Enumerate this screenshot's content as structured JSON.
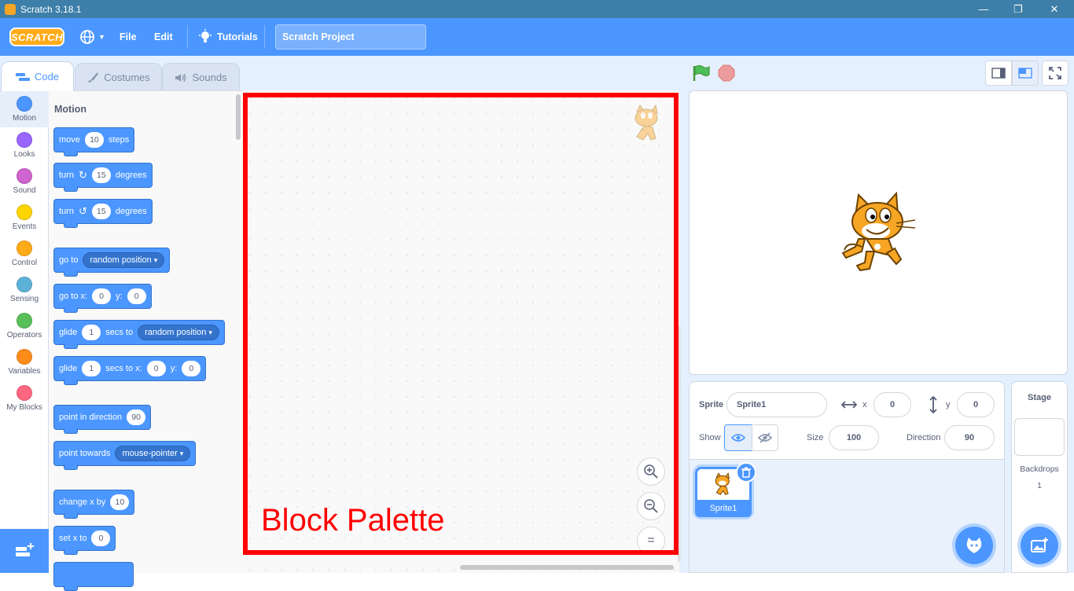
{
  "window": {
    "title": "Scratch 3.18.1",
    "minimize": "—",
    "restore": "❐",
    "close": "✕"
  },
  "menubar": {
    "logo": "SCRATCH",
    "file": "File",
    "edit": "Edit",
    "tutorials": "Tutorials",
    "project_title": "Scratch Project"
  },
  "tabs": {
    "code": "Code",
    "costumes": "Costumes",
    "sounds": "Sounds"
  },
  "categories": [
    {
      "label": "Motion",
      "color": "#4c97ff"
    },
    {
      "label": "Looks",
      "color": "#9966ff"
    },
    {
      "label": "Sound",
      "color": "#cf63cf"
    },
    {
      "label": "Events",
      "color": "#ffd500"
    },
    {
      "label": "Control",
      "color": "#ffab19"
    },
    {
      "label": "Sensing",
      "color": "#5cb1d6"
    },
    {
      "label": "Operators",
      "color": "#59c059"
    },
    {
      "label": "Variables",
      "color": "#ff8c1a"
    },
    {
      "label": "My Blocks",
      "color": "#ff6680"
    }
  ],
  "palette": {
    "heading": "Motion",
    "move": {
      "a": "move",
      "n": "10",
      "b": "steps"
    },
    "turn_right": {
      "a": "turn",
      "n": "15",
      "b": "degrees"
    },
    "turn_left": {
      "a": "turn",
      "n": "15",
      "b": "degrees"
    },
    "go_to": {
      "a": "go to",
      "d": "random position"
    },
    "go_to_xy": {
      "a": "go to x:",
      "x": "0",
      "b": "y:",
      "y": "0"
    },
    "glide_to": {
      "a": "glide",
      "n": "1",
      "b": "secs to",
      "d": "random position"
    },
    "glide_xy": {
      "a": "glide",
      "n": "1",
      "b": "secs to x:",
      "x": "0",
      "c": "y:",
      "y": "0"
    },
    "point_dir": {
      "a": "point in direction",
      "n": "90"
    },
    "point_towards": {
      "a": "point towards",
      "d": "mouse-pointer"
    },
    "change_x": {
      "a": "change x by",
      "n": "10"
    },
    "set_x": {
      "a": "set x to",
      "n": "0"
    }
  },
  "script_area": {
    "caption": "Block Palette",
    "zoom_in": "+",
    "zoom_out": "−",
    "zoom_reset": "="
  },
  "sprite_info": {
    "sprite_label": "Sprite",
    "sprite_name": "Sprite1",
    "x_label": "x",
    "x": "0",
    "y_label": "y",
    "y": "0",
    "show_label": "Show",
    "size_label": "Size",
    "size": "100",
    "direction_label": "Direction",
    "direction": "90"
  },
  "sprite_list": {
    "sprite1": "Sprite1"
  },
  "stage_panel": {
    "title": "Stage",
    "backdrops_label": "Backdrops",
    "backdrops_count": "1"
  }
}
